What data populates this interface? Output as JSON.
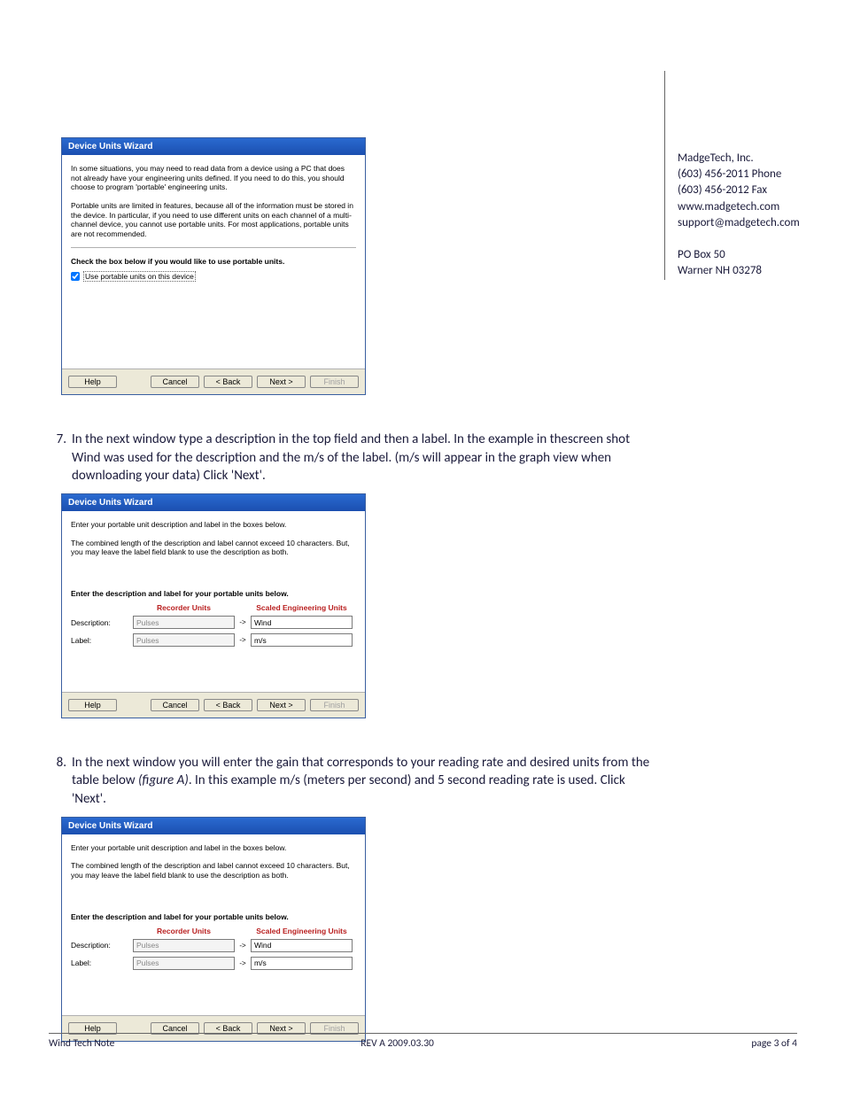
{
  "sidebar": {
    "company": "MadgeTech, Inc.",
    "phone": "(603) 456-2011 Phone",
    "fax": "(603) 456-2012 Fax",
    "web": "www.madgetech.com",
    "email": "support@madgetech.com",
    "addr1": "PO Box 50",
    "addr2": "Warner NH 03278"
  },
  "steps": {
    "s7_num": "7.",
    "s7_text": "In the next window type a description in the top field and then a label. In the example in thescreen shot Wind was used for the description and the m/s of the label. (m/s will appear in the graph view when downloading your data) Click 'Next'.",
    "s8_num": "8.",
    "s8_text_a": "In the next window you will enter the gain that corresponds to your reading rate and desired units from the table below ",
    "s8_text_b": "(figure A)",
    "s8_text_c": ". In this example m/s (meters per second) and 5 second reading rate is used. Click 'Next'."
  },
  "wizard": {
    "title": "Device Units Wizard",
    "w1_p1": "In some situations, you may need to read data from a device using a PC that does not already have your engineering units defined. If you need to do this, you should choose to program 'portable' engineering units.",
    "w1_p2": "Portable units are limited in features, because all of the information must be stored in the device. In particular, if you need to use different units on each channel of a multi-channel device, you cannot use portable units. For most applications, portable units are not recommended.",
    "w1_prompt": "Check the box below if you would like to use portable units.",
    "w1_checkbox": "Use portable units on this device",
    "w2_p1": "Enter your portable unit description and label in the boxes below.",
    "w2_p2": "The combined length of the description and label cannot exceed 10 characters. But, you may leave the label field blank to use the description as both.",
    "w2_prompt": "Enter the description and label for your portable units below.",
    "col_recorder": "Recorder Units",
    "col_scaled": "Scaled Engineering Units",
    "lbl_description": "Description:",
    "lbl_label": "Label:",
    "val_pulses": "Pulses",
    "val_wind": "Wind",
    "val_ms": "m/s",
    "arrow": "->",
    "btn_help": "Help",
    "btn_cancel": "Cancel",
    "btn_back": "< Back",
    "btn_next": "Next >",
    "btn_finish": "Finish"
  },
  "footer": {
    "left": "Wind Tech Note",
    "mid": "REV A 2009.03.30",
    "right": "page 3 of 4"
  }
}
